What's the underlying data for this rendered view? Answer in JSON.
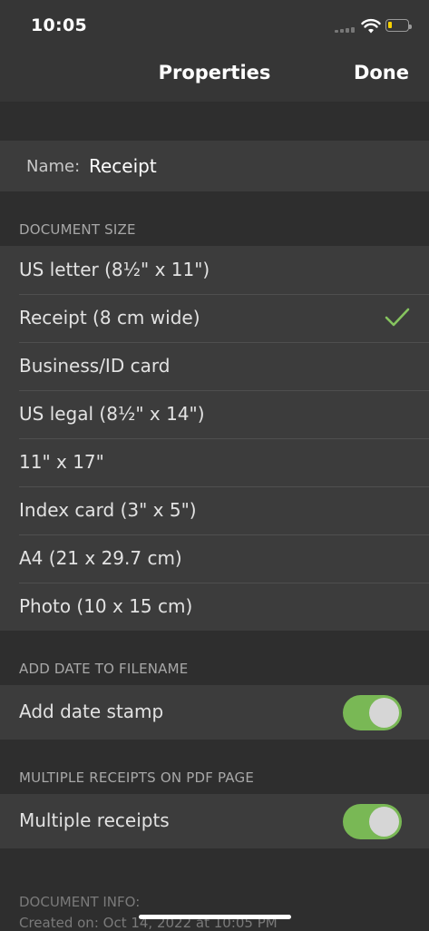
{
  "status_bar": {
    "time": "10:05"
  },
  "nav": {
    "title": "Properties",
    "done_label": "Done"
  },
  "name_field": {
    "label": "Name:",
    "value": "Receipt"
  },
  "document_size": {
    "header": "DOCUMENT SIZE",
    "selected": "Receipt (8 cm wide)",
    "options": [
      "US letter (8½\" x 11\")",
      "Receipt (8 cm wide)",
      "Business/ID card",
      "US legal (8½\" x 14\")",
      "11\" x 17\"",
      "Index card (3\" x 5\")",
      "A4 (21 x 29.7 cm)",
      "Photo (10 x 15 cm)"
    ]
  },
  "date_section": {
    "header": "ADD DATE TO FILENAME",
    "toggle_label": "Add date stamp",
    "enabled": true
  },
  "multiple_section": {
    "header": "MULTIPLE RECEIPTS ON PDF PAGE",
    "toggle_label": "Multiple receipts",
    "enabled": true
  },
  "document_info": {
    "header": "DOCUMENT INFO:",
    "created": "Created on: Oct 14, 2022 at 10:05 PM"
  },
  "colors": {
    "accent_green": "#79b855",
    "checkmark": "#86c45f",
    "row_background": "#3c3c3c",
    "page_background": "#2e2e2e"
  }
}
